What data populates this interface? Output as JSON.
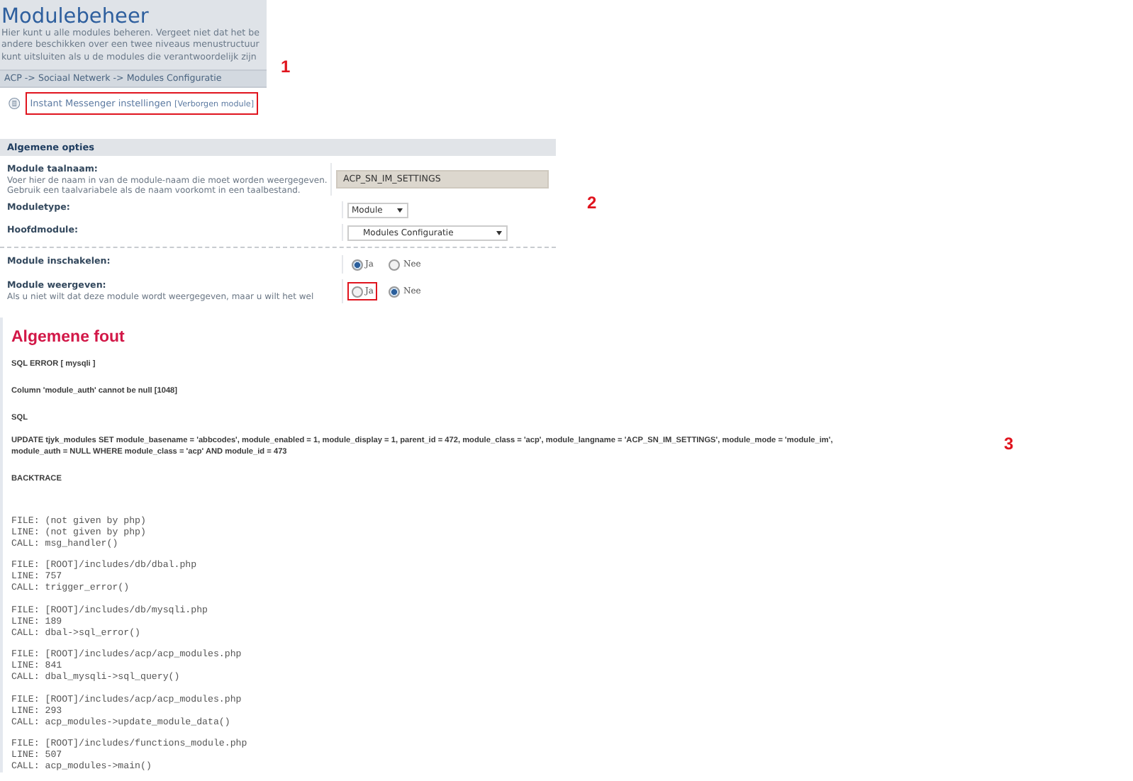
{
  "module_panel": {
    "marker": "1",
    "title": "Modulebeheer",
    "intro": [
      "Hier kunt u alle modules beheren. Vergeet niet dat het be",
      "andere beschikken over een twee niveaus menustructuur",
      "kunt uitsluiten als u de modules die verantwoordelijk zijn"
    ],
    "breadcrumb": "ACP -> Sociaal Netwerk -> Modules Configuratie",
    "module_link": {
      "label": "Instant Messenger instellingen",
      "tag": "[Verborgen module]",
      "highlighted": true
    }
  },
  "options_panel": {
    "marker": "2",
    "legend": "Algemene opties",
    "fieldsets": [
      [
        {
          "kind": "text",
          "label": "Module taalnaam:",
          "explain": [
            "Voer hier de naam in van de module-naam die moet worden weergegeven.",
            "Gebruik een taalvariabele als de naam voorkomt in een taalbestand."
          ],
          "value": "ACP_SN_IM_SETTINGS"
        },
        {
          "kind": "select",
          "label": "Moduletype:",
          "value": "Module",
          "wide": false
        },
        {
          "kind": "select",
          "label": "Hoofdmodule:",
          "value": "Modules Configuratie",
          "wide": true
        }
      ],
      [
        {
          "kind": "radio",
          "label": "Module inschakelen:",
          "options": [
            {
              "label": "Ja",
              "selected": true,
              "highlighted": false
            },
            {
              "label": "Nee",
              "selected": false,
              "highlighted": false
            }
          ]
        },
        {
          "kind": "radio",
          "label": "Module weergeven:",
          "explain": [
            "Als u niet wilt dat deze module wordt weergegeven, maar u wilt het wel"
          ],
          "options": [
            {
              "label": "Ja",
              "selected": false,
              "highlighted": true
            },
            {
              "label": "Nee",
              "selected": true,
              "highlighted": false
            }
          ]
        }
      ]
    ]
  },
  "error_panel": {
    "marker": "3",
    "title": "Algemene fout",
    "paragraphs": [
      "SQL ERROR [ mysqli ]",
      "Column 'module_auth' cannot be null [1048]",
      "SQL"
    ],
    "sql_lines": [
      "UPDATE tjyk_modules SET module_basename = 'abbcodes', module_enabled = 1, module_display = 1, parent_id = 472, module_class = 'acp', module_langname = 'ACP_SN_IM_SETTINGS', module_mode = 'module_im',",
      "module_auth = NULL WHERE module_class = 'acp' AND module_id = 473"
    ],
    "backtrace_heading": "BACKTRACE",
    "backtrace": [
      {
        "file": "FILE: (not given by php)",
        "line": "LINE: (not given by php)",
        "call": "CALL: msg_handler()"
      },
      {
        "file": "FILE: [ROOT]/includes/db/dbal.php",
        "line": "LINE: 757",
        "call": "CALL: trigger_error()"
      },
      {
        "file": "FILE: [ROOT]/includes/db/mysqli.php",
        "line": "LINE: 189",
        "call": "CALL: dbal->sql_error()"
      },
      {
        "file": "FILE: [ROOT]/includes/acp/acp_modules.php",
        "line": "LINE: 841",
        "call": "CALL: dbal_mysqli->sql_query()"
      },
      {
        "file": "FILE: [ROOT]/includes/acp/acp_modules.php",
        "line": "LINE: 293",
        "call": "CALL: acp_modules->update_module_data()"
      },
      {
        "file": "FILE: [ROOT]/includes/functions_module.php",
        "line": "LINE: 507",
        "call": "CALL: acp_modules->main()"
      }
    ]
  }
}
